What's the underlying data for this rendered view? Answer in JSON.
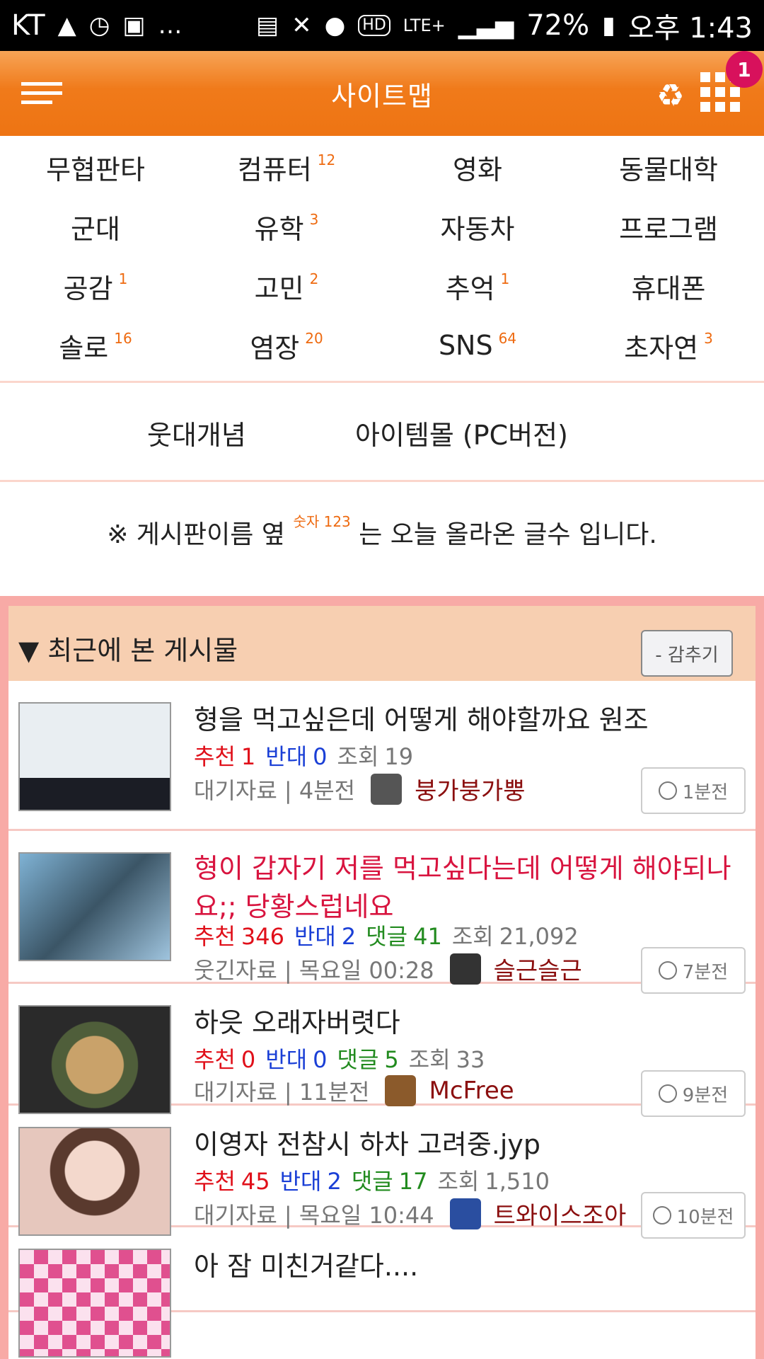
{
  "status_bar": {
    "carrier": "KT",
    "battery": "72%",
    "time": "오후 1:43",
    "left_icons": [
      "graduation-cap-icon",
      "alarm-clock-icon",
      "image-icon",
      "more-dots-icon"
    ],
    "right_icons": [
      "clipboard-icon",
      "mute-icon",
      "alarm-icon",
      "hd-icon",
      "lte-icon",
      "signal-icon",
      "battery-icon"
    ]
  },
  "header": {
    "title": "사이트맵",
    "badge_count": "1",
    "accent_color": "#f07a1a"
  },
  "sitemap": [
    {
      "label": "무협판타",
      "count": ""
    },
    {
      "label": "컴퓨터",
      "count": "12"
    },
    {
      "label": "영화",
      "count": ""
    },
    {
      "label": "동물대학",
      "count": ""
    },
    {
      "label": "군대",
      "count": ""
    },
    {
      "label": "유학",
      "count": "3"
    },
    {
      "label": "자동차",
      "count": ""
    },
    {
      "label": "프로그램",
      "count": ""
    },
    {
      "label": "공감",
      "count": "1"
    },
    {
      "label": "고민",
      "count": "2"
    },
    {
      "label": "추억",
      "count": "1"
    },
    {
      "label": "휴대폰",
      "count": ""
    },
    {
      "label": "솔로",
      "count": "16"
    },
    {
      "label": "염장",
      "count": "20"
    },
    {
      "label": "SNS",
      "count": "64"
    },
    {
      "label": "초자연",
      "count": "3"
    }
  ],
  "links": {
    "concept": "웃대개념",
    "itemmall": "아이템몰 (PC버전)"
  },
  "notice": {
    "prefix": "※ 게시판이름 옆",
    "sup": "숫자 123",
    "suffix": "는 오늘 올라온 글수 입니다."
  },
  "recent": {
    "title": "▼ 최근에 본 게시물",
    "hide_label": "- 감추기",
    "posts": [
      {
        "title": "형을 먹고싶은데 어떻게 해야할까요 원조",
        "hot": false,
        "rec_label": "추천",
        "rec": "1",
        "opp_label": "반대",
        "opp": "0",
        "cmt_label": "",
        "cmt": "",
        "view_label": "조회",
        "view": "19",
        "category": "대기자료 | 4분전",
        "author": "붕가붕가뿡",
        "time_btn": "1분전"
      },
      {
        "title": "형이 갑자기 저를 먹고싶다는데 어떻게 해야되나요;; 당황스럽네요",
        "hot": true,
        "rec_label": "추천",
        "rec": "346",
        "opp_label": "반대",
        "opp": "2",
        "cmt_label": "댓글",
        "cmt": "41",
        "view_label": "조회",
        "view": "21,092",
        "category": "웃긴자료 | 목요일 00:28",
        "author": "슬근슬근",
        "time_btn": "7분전"
      },
      {
        "title": "하읏 오래자버렷다",
        "hot": false,
        "rec_label": "추천",
        "rec": "0",
        "opp_label": "반대",
        "opp": "0",
        "cmt_label": "댓글",
        "cmt": "5",
        "view_label": "조회",
        "view": "33",
        "category": "대기자료 | 11분전",
        "author": "McFree",
        "time_btn": "9분전"
      },
      {
        "title": "이영자 전참시 하차 고려중.jyp",
        "hot": false,
        "rec_label": "추천",
        "rec": "45",
        "opp_label": "반대",
        "opp": "2",
        "cmt_label": "댓글",
        "cmt": "17",
        "view_label": "조회",
        "view": "1,510",
        "category": "대기자료 | 목요일 10:44",
        "author": "트와이스조아",
        "time_btn": "10분전"
      },
      {
        "title": "아 잠 미친거같다....",
        "hot": false
      }
    ]
  }
}
